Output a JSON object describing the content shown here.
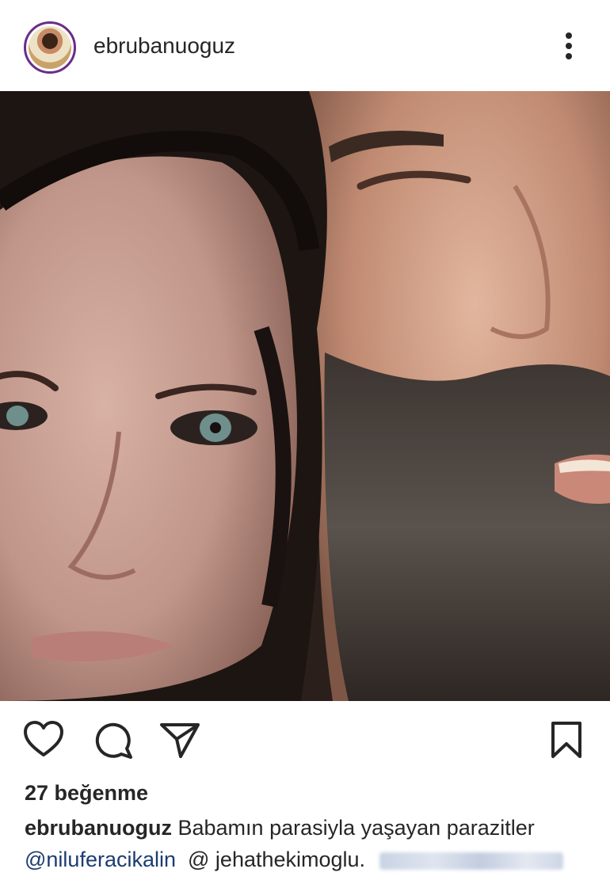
{
  "post": {
    "username": "ebrubanuoguz",
    "likes": "27 beğenme",
    "caption_user": "ebrubanuoguz",
    "caption_text": "Babamın parasiyla yaşayan parazitler",
    "tag_1": "@niluferacikalin",
    "tag_2": "@ jehathekimoglu."
  },
  "icons": {
    "more": "more-options-icon",
    "like": "heart-icon",
    "comment": "comment-bubble-icon",
    "share": "paper-plane-icon",
    "save": "bookmark-icon"
  },
  "colors": {
    "avatar_ring": "#6b2c8a",
    "text": "#262626",
    "mention": "#1c3c72"
  }
}
